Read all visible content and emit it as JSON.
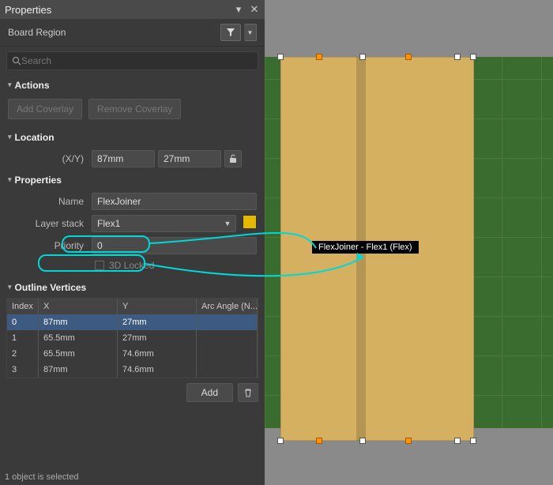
{
  "panel": {
    "title": "Properties",
    "object_type": "Board Region",
    "search_placeholder": "Search",
    "status": "1 object is selected"
  },
  "actions": {
    "header": "Actions",
    "add_coverlay": "Add Coverlay",
    "remove_coverlay": "Remove Coverlay"
  },
  "location": {
    "header": "Location",
    "xy_label": "(X/Y)",
    "x": "87mm",
    "y": "27mm"
  },
  "properties": {
    "header": "Properties",
    "name_label": "Name",
    "name_value": "FlexJoiner",
    "layerstack_label": "Layer stack",
    "layerstack_value": "Flex1",
    "layerstack_color": "#e6b800",
    "priority_label": "Priority",
    "priority_value": "0",
    "locked_label": "3D Locked"
  },
  "vertices": {
    "header": "Outline Vertices",
    "columns": {
      "index": "Index",
      "x": "X",
      "y": "Y",
      "arc": "Arc Angle (N..."
    },
    "rows": [
      {
        "index": "0",
        "x": "87mm",
        "y": "27mm",
        "arc": ""
      },
      {
        "index": "1",
        "x": "65.5mm",
        "y": "27mm",
        "arc": ""
      },
      {
        "index": "2",
        "x": "65.5mm",
        "y": "74.6mm",
        "arc": ""
      },
      {
        "index": "3",
        "x": "87mm",
        "y": "74.6mm",
        "arc": ""
      }
    ],
    "add_label": "Add"
  },
  "canvas": {
    "tooltip": "FlexJoiner - Flex1 (Flex)"
  }
}
